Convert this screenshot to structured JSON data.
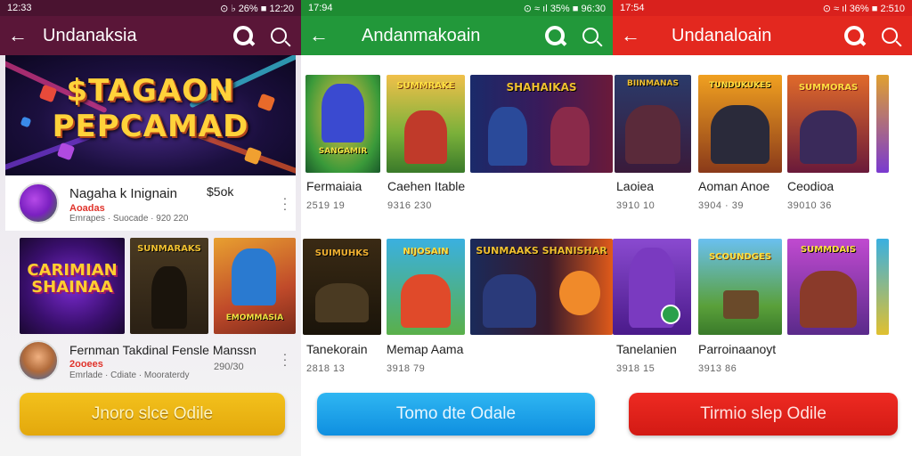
{
  "panels": [
    {
      "status_time": "12:33",
      "status_right": "⊙ ♭ 26% ■ 12:20",
      "title": "Undanaksia",
      "banner_line1": "$TAGAON",
      "banner_line2": "PEPCAMAD",
      "row1": {
        "title": "Nagaha k Inignain",
        "size": "$5ok",
        "subtitle": "Aoadas",
        "meta": "Emrapes · Suocade · 920 220"
      },
      "thumbs": [
        "CARIMIAN SHAINAA",
        "SUNMARAKS",
        "EMOMMASIA"
      ],
      "row2": {
        "title": "Fernman Takdinal Fensle Manssn",
        "size": "290/30",
        "subtitle": "2ooees",
        "meta": "Emrlade · Cdiate · Mooraterdy"
      },
      "button": "Jnoro slce Odile",
      "colors": {
        "bar": "#5a1638",
        "button": "#e3a80c"
      }
    },
    {
      "status_time": "17:94",
      "status_right": "⊙ ≈ ıl 35% ■ 96:30",
      "title": "Andanmakoain",
      "games_top": [
        {
          "name": "Fermaiaia",
          "meta": "2519 19",
          "art": "SANGAMIR"
        },
        {
          "name": "Caehen Itable",
          "meta": "9316 230",
          "art": "SUMMRAKE"
        },
        {
          "name": "",
          "meta": "",
          "art": "SHAHAIKAS"
        }
      ],
      "games_bottom": [
        {
          "name": "Tanekorain",
          "meta": "2818 13",
          "art": "SUIMUHKS"
        },
        {
          "name": "Memap Aama",
          "meta": "3918 79",
          "art": "NIJOSAIN"
        },
        {
          "name": "",
          "meta": "",
          "art": "SUNMAAKS SHANISHAR"
        }
      ],
      "button": "Tomo dte Odale",
      "colors": {
        "bar": "#22983a",
        "button": "#1c9ae6"
      }
    },
    {
      "status_time": "17:54",
      "status_right": "⊙ ≈ ıl 36% ■ 2:510",
      "title": "Undanaloain",
      "games_top": [
        {
          "name": "Laoiea",
          "meta": "3910 10",
          "art": "BIINMANAS"
        },
        {
          "name": "Aoman Anoe",
          "meta": "3904 · 39",
          "art": "TUNDUKUKES"
        },
        {
          "name": "Ceodioa",
          "meta": "39010 36",
          "art": "SUMMORAS"
        }
      ],
      "games_bottom": [
        {
          "name": "Tanelanien",
          "meta": "3918 15",
          "art": ""
        },
        {
          "name": "Parroinaanoyt",
          "meta": "3913 86",
          "art": "SCOUNDGES"
        },
        {
          "name": "",
          "meta": "",
          "art": "SUMMDAIS"
        }
      ],
      "button": "Tirmio slep Odile",
      "colors": {
        "bar": "#e3281f",
        "button": "#d21a14"
      }
    }
  ]
}
